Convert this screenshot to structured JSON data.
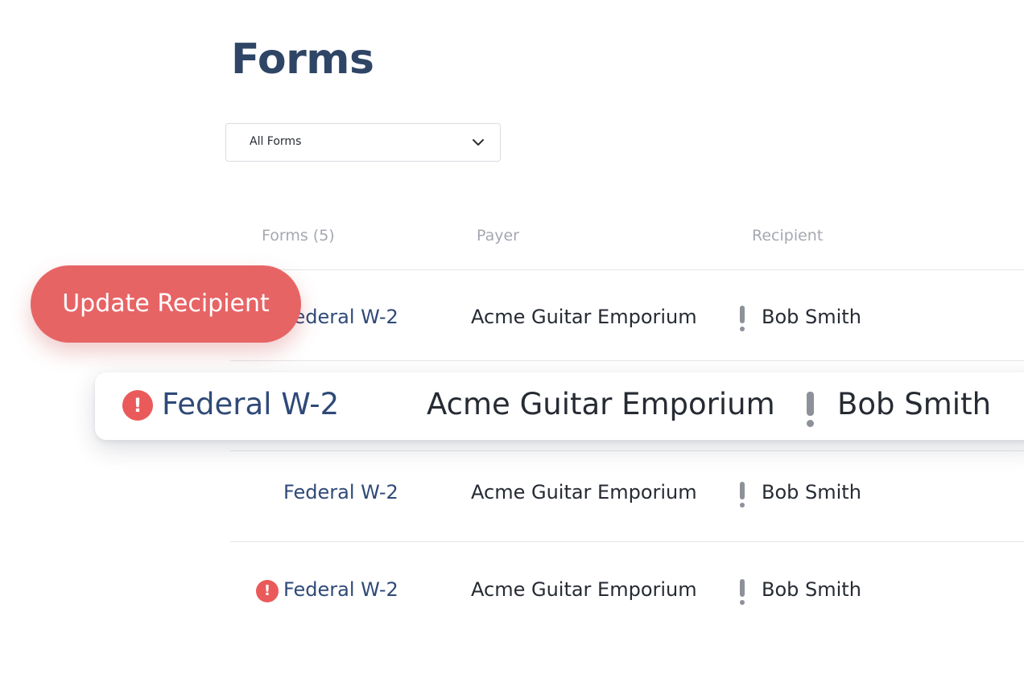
{
  "page": {
    "title": "Forms"
  },
  "filter": {
    "selected": "All Forms"
  },
  "table": {
    "headers": {
      "forms": "Forms (5)",
      "payer": "Payer",
      "recipient": "Recipient"
    },
    "rows": [
      {
        "form": "Federal W-2",
        "payer": "Acme Guitar Emporium",
        "recipient": "Bob Smith",
        "form_alert": false,
        "recipient_warning": true
      },
      {
        "form": "Federal W-2",
        "payer": "Acme Guitar Emporium",
        "recipient": "Bob Smith",
        "form_alert": true,
        "recipient_warning": true
      },
      {
        "form": "Federal W-2",
        "payer": "Acme Guitar Emporium",
        "recipient": "Bob Smith",
        "form_alert": false,
        "recipient_warning": true
      },
      {
        "form": "Federal W-2",
        "payer": "Acme Guitar Emporium",
        "recipient": "Bob Smith",
        "form_alert": true,
        "recipient_warning": true
      }
    ]
  },
  "overlay": {
    "update_button_label": "Update Recipient"
  },
  "icons": {
    "select_indicator": "chevron-down-icon",
    "form_alert": "alert-circle-icon",
    "recipient_warning": "exclamation-icon"
  },
  "colors": {
    "title": "#2f4566",
    "link": "#2f4a78",
    "alert": "#ea5a5a",
    "button": "#e76465",
    "warning": "#8d9199"
  }
}
